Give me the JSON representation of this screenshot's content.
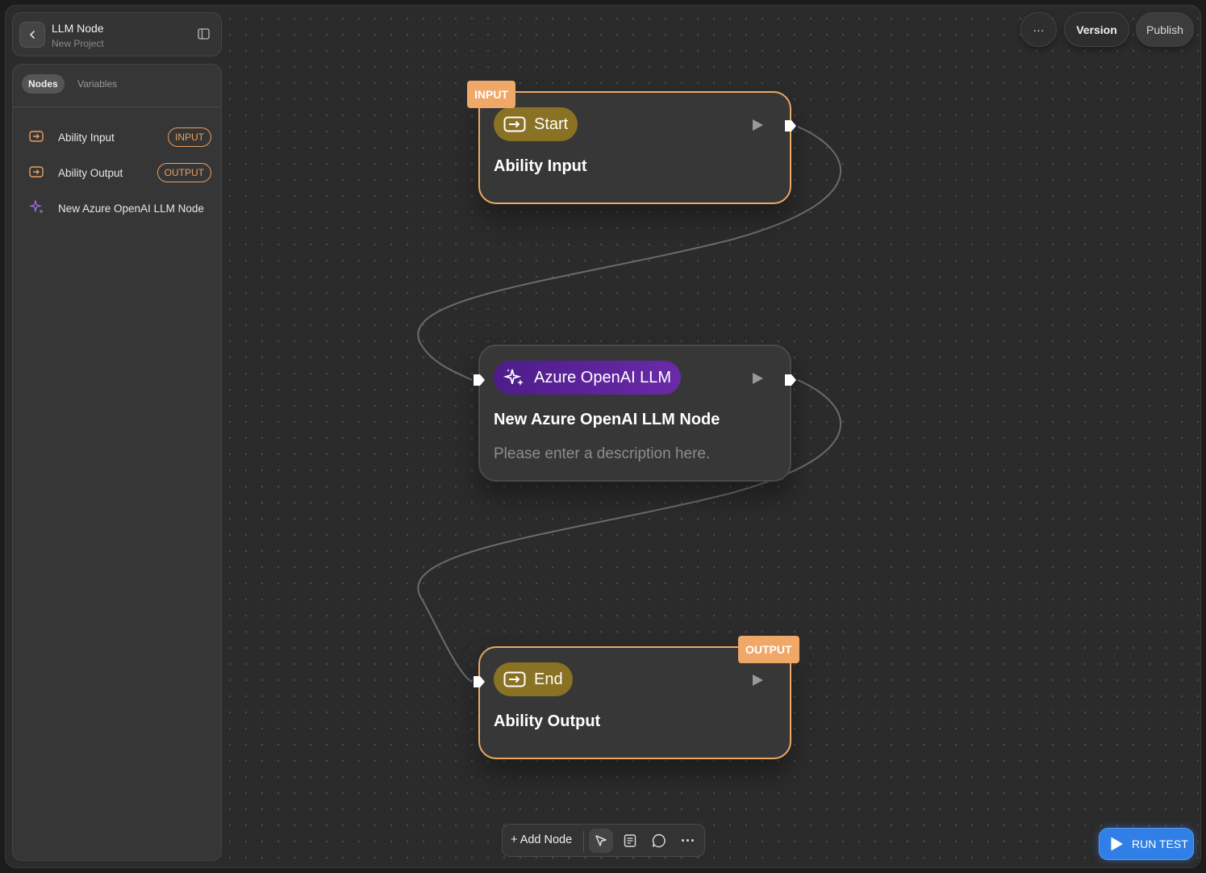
{
  "header": {
    "title": "LLM Node",
    "subtitle": "New Project"
  },
  "sidebar": {
    "tabs": [
      {
        "label": "Nodes",
        "active": true
      },
      {
        "label": "Variables",
        "active": false
      }
    ],
    "items": [
      {
        "label": "Ability Input",
        "badge": "INPUT",
        "icon": "input-arrow-icon"
      },
      {
        "label": "Ability Output",
        "badge": "OUTPUT",
        "icon": "input-arrow-icon"
      },
      {
        "label": "New Azure OpenAI LLM Node",
        "badge": "",
        "icon": "sparkle-icon"
      }
    ]
  },
  "topbar": {
    "more_label": "···",
    "version_label": "Version",
    "publish_label": "Publish"
  },
  "nodes": [
    {
      "tag": "INPUT",
      "pill": "Start",
      "title": "Ability Input",
      "description": ""
    },
    {
      "tag": "",
      "pill": "Azure OpenAI LLM",
      "title": "New Azure OpenAI LLM Node",
      "description": "Please enter a description here."
    },
    {
      "tag": "OUTPUT",
      "pill": "End",
      "title": "Ability Output",
      "description": ""
    }
  ],
  "toolbar": {
    "add_node_label": "+ Add Node",
    "more_label": "···"
  },
  "run_test_label": "RUN TEST",
  "colors": {
    "accent_orange": "#e9a963",
    "io_pill": "#8a7224",
    "llm_pill": "#5a22a0",
    "run_blue": "#2f7fe6"
  }
}
